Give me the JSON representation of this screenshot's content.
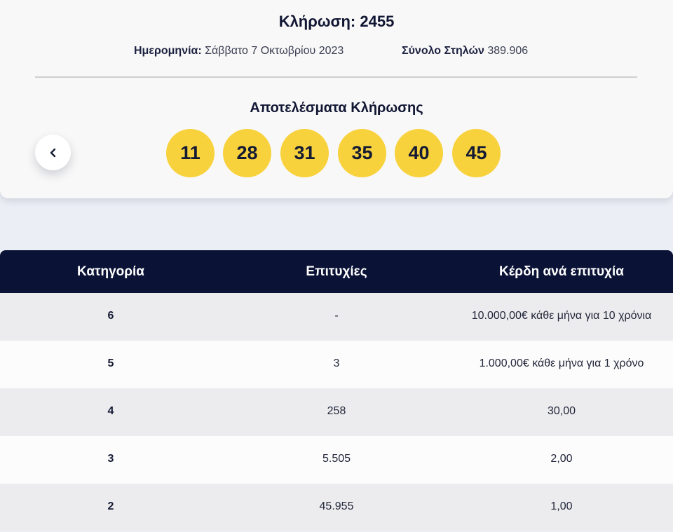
{
  "header": {
    "draw_title": "Κλήρωση: 2455",
    "date_label": "Ημερομηνία:",
    "date_value": "Σάββατο 7 Οκτωβρίου 2023",
    "total_label": "Σύνολο Στηλών",
    "total_value": "389.906"
  },
  "results": {
    "title": "Αποτελέσματα Κλήρωσης",
    "numbers": [
      "11",
      "28",
      "31",
      "35",
      "40",
      "45"
    ],
    "ball_color": "#f8d23d"
  },
  "nav": {
    "prev_icon": "chevron-left-icon"
  },
  "table": {
    "header_color": "#0a1236",
    "columns": [
      "Κατηγορία",
      "Επιτυχίες",
      "Κέρδη ανά επιτυχία"
    ],
    "rows": [
      {
        "category": "6",
        "winners": "-",
        "prize": "10.000,00€ κάθε μήνα για 10 χρόνια"
      },
      {
        "category": "5",
        "winners": "3",
        "prize": "1.000,00€ κάθε μήνα για 1 χρόνο"
      },
      {
        "category": "4",
        "winners": "258",
        "prize": "30,00"
      },
      {
        "category": "3",
        "winners": "5.505",
        "prize": "2,00"
      },
      {
        "category": "2",
        "winners": "45.955",
        "prize": "1,00"
      }
    ]
  }
}
